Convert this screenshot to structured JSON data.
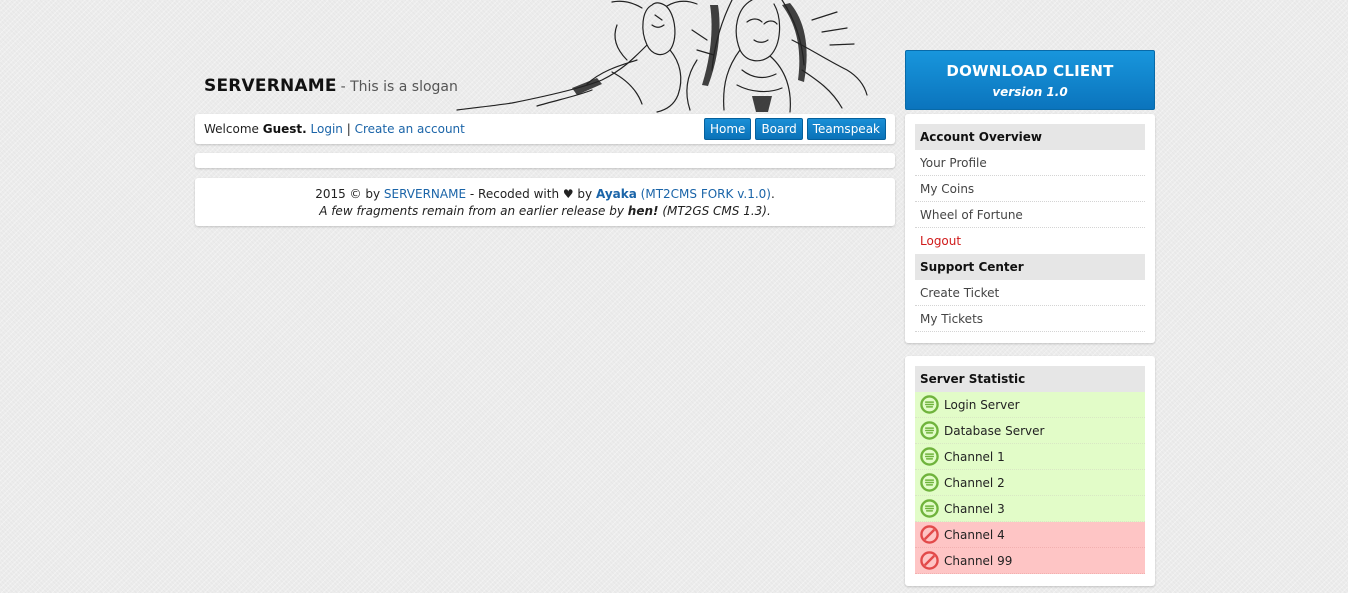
{
  "header": {
    "site_name": "SERVERNAME",
    "slogan": "- This is a slogan"
  },
  "welcome": {
    "welcome_label": "Welcome",
    "user": "Guest.",
    "login_link": "Login",
    "separator": "|",
    "register_link": "Create an account"
  },
  "nav": {
    "home": "Home",
    "board": "Board",
    "teamspeak": "Teamspeak"
  },
  "footer": {
    "copyright": "2015 © by",
    "server_link": "SERVERNAME",
    "recoded_text": "- Recoded with ♥ by",
    "author": "Ayaka",
    "fork_label": "(MT2CMS FORK v.1.0)",
    "end_period": ".",
    "fragments_text": "A few fragments remain from an earlier release by",
    "fragments_author": "hen!",
    "fragments_version": "(MT2GS CMS 1.3)."
  },
  "download": {
    "title": "DOWNLOAD CLIENT",
    "version": "version 1.0"
  },
  "account": {
    "heading": "Account Overview",
    "items": [
      "Your Profile",
      "My Coins",
      "Wheel of Fortune"
    ],
    "logout": "Logout"
  },
  "support": {
    "heading": "Support Center",
    "items": [
      "Create Ticket",
      "My Tickets"
    ]
  },
  "stats": {
    "heading": "Server Statistic",
    "servers": [
      {
        "name": "Login Server",
        "status": "online"
      },
      {
        "name": "Database Server",
        "status": "online"
      },
      {
        "name": "Channel 1",
        "status": "online"
      },
      {
        "name": "Channel 2",
        "status": "online"
      },
      {
        "name": "Channel 3",
        "status": "online"
      },
      {
        "name": "Channel 4",
        "status": "offline"
      },
      {
        "name": "Channel 99",
        "status": "offline"
      }
    ]
  },
  "colors": {
    "accent_blue": "#0b7dc6",
    "online_bg": "#e2fcc8",
    "offline_bg": "#fec5c5",
    "online_icon": "#6fb33c",
    "offline_icon": "#e24a4a"
  }
}
